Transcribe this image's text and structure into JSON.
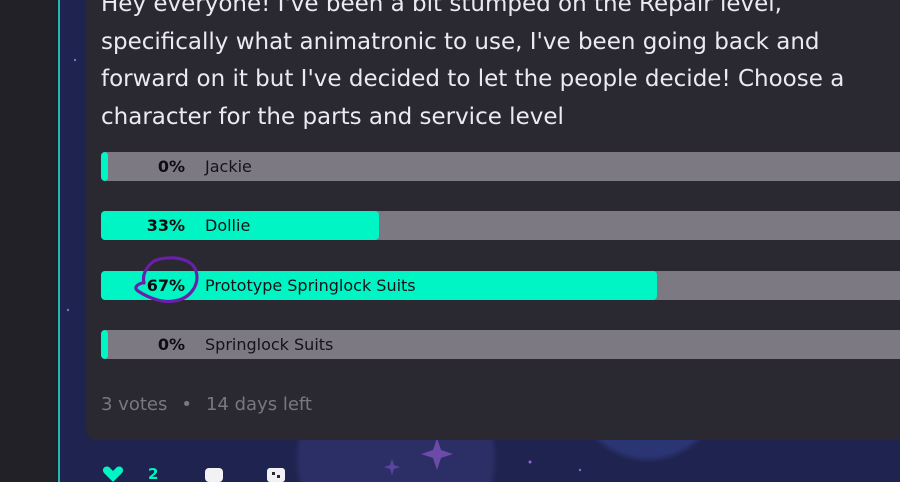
{
  "post": {
    "body": "Hey everyone! I've been a bit stumped on the Repair level, specifically what animatronic to use, I've been going back and forward on it but I've decided to let the people decide! Choose a character for the parts and service level"
  },
  "poll": {
    "options": [
      {
        "percent_label": "0%",
        "label": "Jackie",
        "fraction": 0.0
      },
      {
        "percent_label": "33%",
        "label": "Dollie",
        "fraction": 0.33
      },
      {
        "percent_label": "67%",
        "label": "Prototype Springlock Suits",
        "fraction": 0.67
      },
      {
        "percent_label": "0%",
        "label": "Springlock Suits",
        "fraction": 0.0
      }
    ],
    "votes": "3 votes",
    "separator": "•",
    "time_left": "14 days left"
  },
  "actions": {
    "like_count": "2"
  },
  "colors": {
    "accent": "#00f5c4",
    "bar_track": "#7c7983",
    "card": "#2a2830",
    "annotation": "#6a1fa8"
  },
  "icons": [
    "heart-icon",
    "comment-icon",
    "share-icon"
  ]
}
